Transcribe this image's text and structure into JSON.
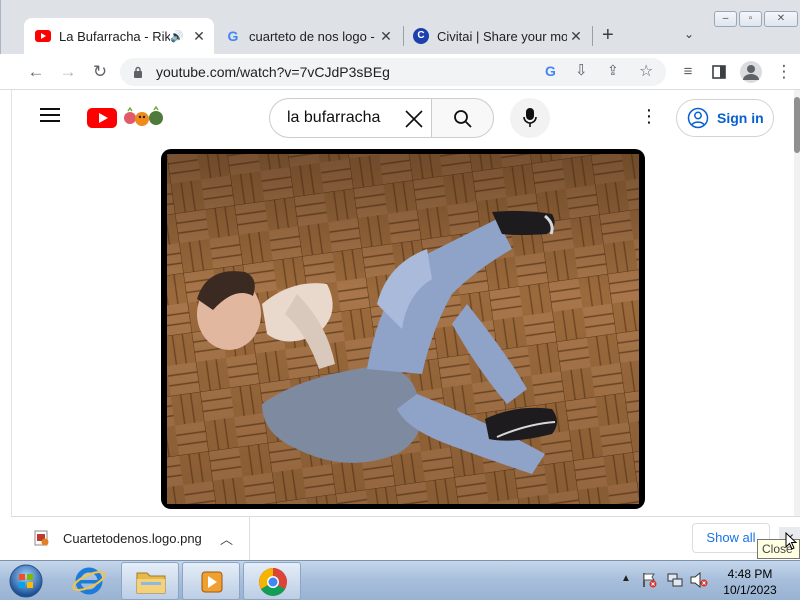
{
  "browser": {
    "tabs": [
      {
        "title": "La Bufarracha - Riki",
        "favicon": "youtube-icon",
        "active": true,
        "audio": true
      },
      {
        "title": "cuarteto de nos logo -",
        "favicon": "google-icon",
        "active": false
      },
      {
        "title": "Civitai | Share your mod",
        "favicon": "civitai-icon",
        "active": false
      }
    ],
    "new_tab_label": "+",
    "window_buttons": [
      "minimize",
      "restore",
      "close"
    ],
    "url": "youtube.com/watch?v=7vCJdP3sBEg"
  },
  "youtube": {
    "search_query": "la bufarracha",
    "sign_in_label": "Sign in"
  },
  "download_bar": {
    "file_name": "Cuartetodenos.logo.png",
    "show_all_label": "Show all",
    "tooltip": "Close"
  },
  "taskbar": {
    "time": "4:48 PM",
    "date": "10/1/2023"
  },
  "colors": {
    "youtube_red": "#ff0000",
    "link_blue": "#065fd4",
    "tab_strip": "#dee1e6"
  }
}
